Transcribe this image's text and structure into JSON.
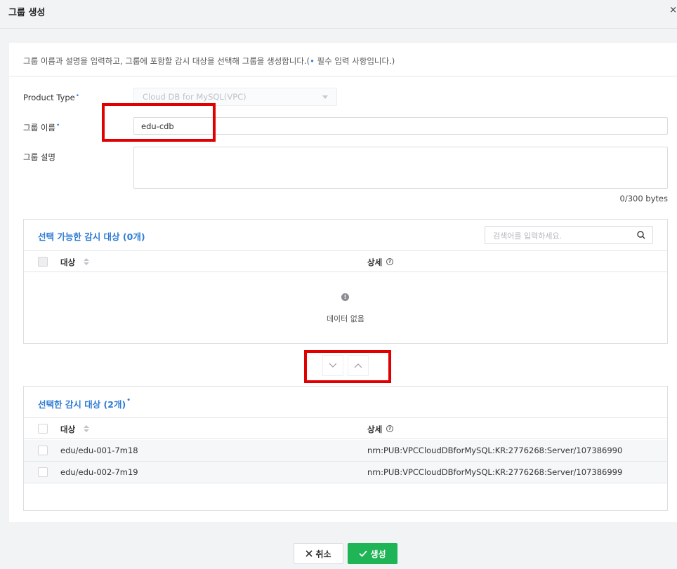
{
  "header": {
    "title": "그룹 생성",
    "close_label": "×"
  },
  "description": {
    "text_before": "그룹 이름과 설명을 입력하고, 그룹에 포함할 감시 대상을 선택해 그룹을 생성합니다.(",
    "dot": "•",
    "text_after": " 필수 입력 사항입니다.)"
  },
  "form": {
    "product_type_label": "Product Type",
    "product_type_value": "Cloud DB for MySQL(VPC)",
    "group_name_label": "그룹 이름",
    "group_name_value": "edu-cdb",
    "group_desc_label": "그룹 설명",
    "group_desc_value": "",
    "byte_counter": "0/300 bytes",
    "required_mark": "•"
  },
  "available": {
    "title": "선택 가능한 감시 대상 (0개)",
    "search_placeholder": "검색어를 입력하세요.",
    "col_target": "대상",
    "col_detail": "상세",
    "empty_icon": "!",
    "empty_text": "데이터 없음"
  },
  "selected": {
    "title": "선택한 감시 대상 (2개)",
    "col_target": "대상",
    "col_detail": "상세",
    "rows": [
      {
        "target": "edu/edu-001-7m18",
        "detail": "nrn:PUB:VPCCloudDBforMySQL:KR:2776268:Server/107386990"
      },
      {
        "target": "edu/edu-002-7m19",
        "detail": "nrn:PUB:VPCCloudDBforMySQL:KR:2776268:Server/107386999"
      }
    ]
  },
  "footer": {
    "cancel_label": "취소",
    "create_label": "생성"
  },
  "colors": {
    "accent_blue": "#2c7bd4",
    "create_green": "#1fb455",
    "highlight_red": "#e00000"
  },
  "icons": {
    "search": "search-icon",
    "move_down": "chevron-down-icon",
    "move_up": "chevron-up-icon",
    "cancel": "close-icon",
    "create": "check-icon"
  }
}
